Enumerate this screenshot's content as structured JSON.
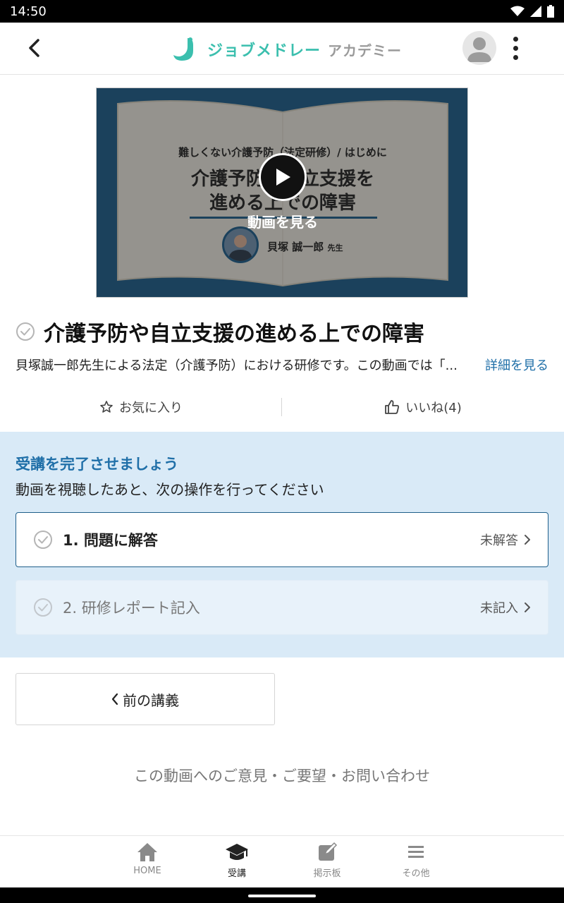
{
  "status_bar": {
    "time": "14:50"
  },
  "header": {
    "logo_text": "ジョブメドレー",
    "logo_sub": "アカデミー"
  },
  "video": {
    "subtitle": "難しくない介護予防（法定研修）/ はじめに",
    "title_line1": "介護予防や自立支援を",
    "title_line2": "進める上での障害",
    "lecturer": "貝塚 誠一郎",
    "lecturer_suffix": "先生",
    "watch_label": "動画を見る"
  },
  "lesson": {
    "title": "介護予防や自立支援の進める上での障害",
    "description": "貝塚誠一郎先生による法定（介護予防）における研修です。この動画では「...",
    "more_link": "詳細を見る"
  },
  "actions": {
    "favorite_label": "お気に入り",
    "like_label": "いいね(4)"
  },
  "completion": {
    "heading": "受講を完了させましょう",
    "subheading": "動画を視聴したあと、次の操作を行ってください",
    "tasks": [
      {
        "label": "1. 問題に解答",
        "status": "未解答"
      },
      {
        "label": "2. 研修レポート記入",
        "status": "未記入"
      }
    ]
  },
  "prev_button": {
    "label": "前の講義"
  },
  "feedback": {
    "label": "この動画へのご意見・ご要望・お問い合わせ"
  },
  "bottom_nav": {
    "items": [
      {
        "label": "HOME",
        "icon": "home-icon"
      },
      {
        "label": "受講",
        "icon": "graduation-cap-icon"
      },
      {
        "label": "掲示板",
        "icon": "edit-icon"
      },
      {
        "label": "その他",
        "icon": "menu-icon"
      }
    ]
  },
  "colors": {
    "accent": "#1f6fa8",
    "brand": "#3bbfae",
    "section_bg": "#d9eaf7"
  }
}
